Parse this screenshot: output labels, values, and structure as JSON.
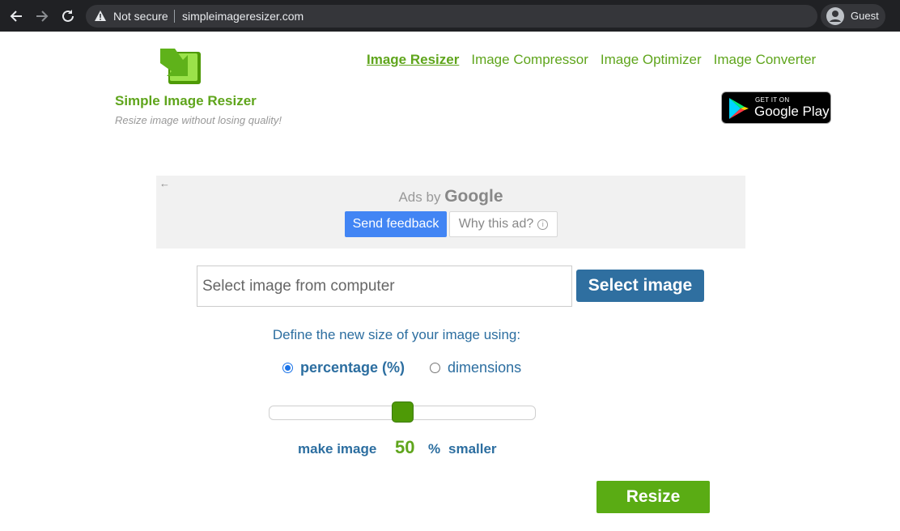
{
  "browser": {
    "security_label": "Not secure",
    "url": "simpleimageresizer.com",
    "profile_label": "Guest"
  },
  "site": {
    "title": "Simple Image Resizer",
    "tagline": "Resize image without losing quality!",
    "brand_color": "#5fa51c"
  },
  "nav": {
    "items": [
      {
        "label": "Image Resizer",
        "active": true
      },
      {
        "label": "Image Compressor",
        "active": false
      },
      {
        "label": "Image Optimizer",
        "active": false
      },
      {
        "label": "Image Converter",
        "active": false
      }
    ]
  },
  "google_play": {
    "top_line": "GET IT ON",
    "store_name": "Google Play"
  },
  "ad": {
    "ads_by_prefix": "Ads by",
    "ads_by_brand": "Google",
    "send_feedback": "Send feedback",
    "why_this_ad": "Why this ad?"
  },
  "upload": {
    "placeholder": "Select image from computer",
    "button_label": "Select image"
  },
  "resize_options": {
    "instruction": "Define the new size of your image using:",
    "option_percentage": "percentage (%)",
    "option_dimensions": "dimensions",
    "selected_option": "percentage",
    "slider_value_percent": 50
  },
  "make_image": {
    "prefix": "make image",
    "value": "50",
    "unit": "%",
    "suffix": "smaller"
  },
  "actions": {
    "resize_label": "Resize"
  }
}
